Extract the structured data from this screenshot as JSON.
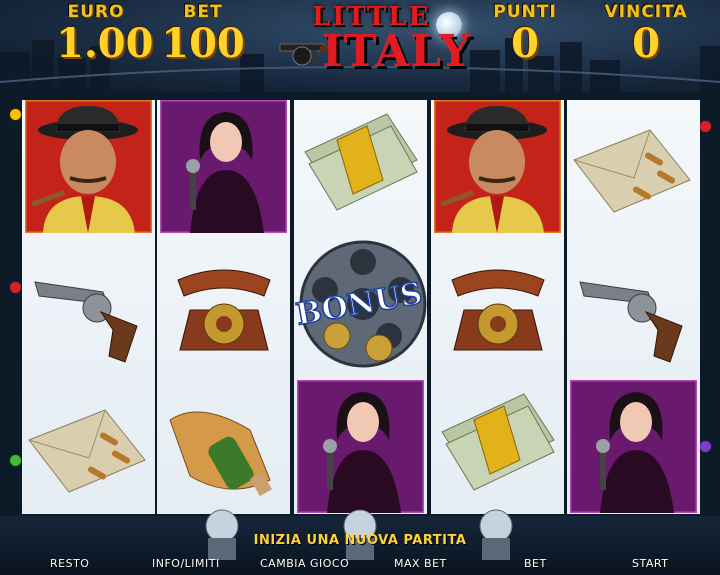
{
  "header": {
    "euro_label": "EURO",
    "euro_value": "1.00",
    "bet_label": "BET",
    "bet_value": "100",
    "logo_line1": "LITTLE",
    "logo_line2": "ITALY",
    "punti_label": "PUNTI",
    "punti_value": "0",
    "vincita_label": "VINCITA",
    "vincita_value": "0"
  },
  "reels": [
    [
      "gangster",
      "revolver",
      "envelope"
    ],
    [
      "singer",
      "telephone",
      "bread-bottle"
    ],
    [
      "money",
      "bonus",
      "singer"
    ],
    [
      "gangster",
      "telephone",
      "money"
    ],
    [
      "envelope",
      "revolver",
      "singer"
    ]
  ],
  "bonus_text": "BONUS",
  "message": "INIZIA UNA NUOVA PARTITA",
  "buttons": {
    "resto": "RESTO",
    "info": "INFO/LIMITI",
    "cambia": "CAMBIA GIOCO",
    "maxbet": "MAX BET",
    "bet": "BET",
    "start": "START"
  },
  "colors": {
    "accent_gold": "#ffd22a",
    "logo_red": "#e21b23",
    "gangster_bg": "#c4231a",
    "singer_bg": "#6a1a6e"
  }
}
